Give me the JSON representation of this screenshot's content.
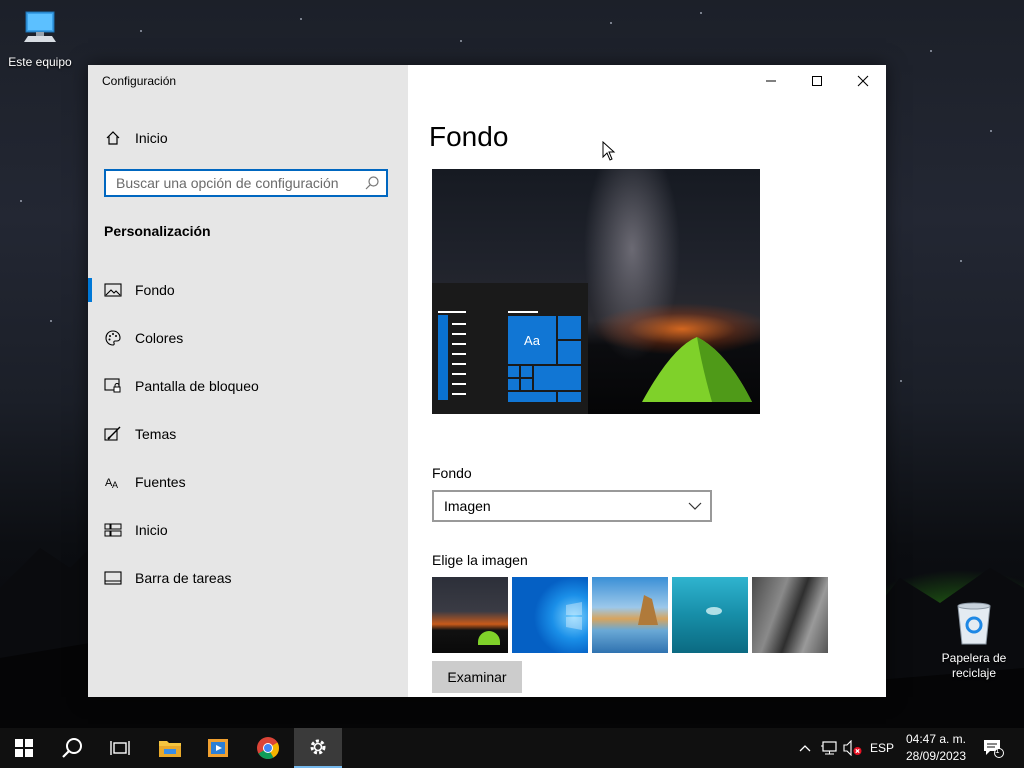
{
  "desktop": {
    "icons": [
      {
        "label": "Este equipo",
        "icon": "computer-icon"
      },
      {
        "label": "Papelera de reciclaje",
        "icon": "recycle-bin-icon"
      }
    ]
  },
  "window": {
    "title": "Configuración",
    "sidebar": {
      "home_label": "Inicio",
      "search_placeholder": "Buscar una opción de configuración",
      "section_title": "Personalización",
      "items": [
        {
          "label": "Fondo",
          "icon": "picture-icon",
          "active": true
        },
        {
          "label": "Colores",
          "icon": "palette-icon",
          "active": false
        },
        {
          "label": "Pantalla de bloqueo",
          "icon": "lock-screen-icon",
          "active": false
        },
        {
          "label": "Temas",
          "icon": "brush-icon",
          "active": false
        },
        {
          "label": "Fuentes",
          "icon": "font-icon",
          "active": false
        },
        {
          "label": "Inicio",
          "icon": "start-layout-icon",
          "active": false
        },
        {
          "label": "Barra de tareas",
          "icon": "taskbar-icon",
          "active": false
        }
      ]
    },
    "content": {
      "page_title": "Fondo",
      "preview_tile_text": "Aa",
      "background_label": "Fondo",
      "background_value": "Imagen",
      "choose_image_label": "Elige la imagen",
      "browse_label": "Examinar"
    }
  },
  "taskbar": {
    "language": "ESP",
    "time": "04:47 a. m.",
    "date": "28/09/2023",
    "notification_count": "1"
  },
  "colors": {
    "accent": "#0078d7",
    "sidebar_bg": "#e6e6e6",
    "taskbar_bg": "#101010"
  }
}
